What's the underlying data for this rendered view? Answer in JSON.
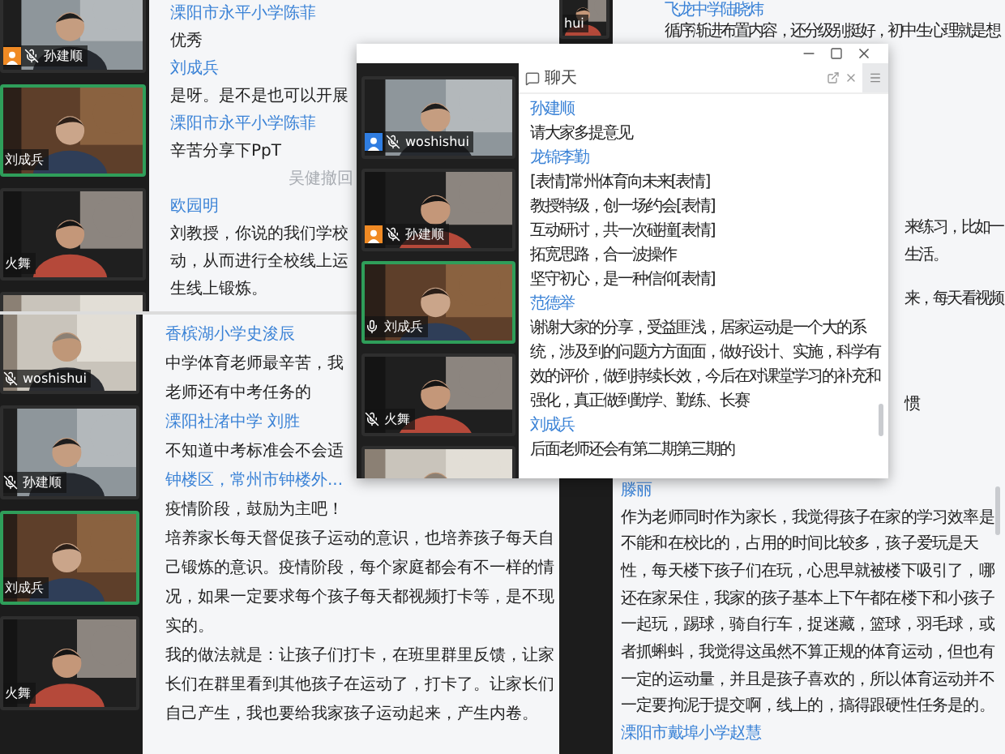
{
  "screens": [
    {
      "tiles": [
        {
          "label": "孙建顺",
          "color": "#f08a24",
          "muted": true,
          "speaking": false
        },
        {
          "label": "刘成兵",
          "speaking": true
        },
        {
          "label": "火舞",
          "speaking": false
        },
        {
          "speaking": false
        }
      ],
      "messages": [
        {
          "kind": "name",
          "text": "溧阳市永平小学陈菲"
        },
        {
          "kind": "text",
          "text": "优秀"
        },
        {
          "kind": "name",
          "text": "刘成兵"
        },
        {
          "kind": "text",
          "text": "是呀。是不是也可以开展"
        },
        {
          "kind": "name",
          "text": "溧阳市永平小学陈菲"
        },
        {
          "kind": "text",
          "text": "辛苦分享下PpT"
        },
        {
          "kind": "notice",
          "text": "吴健撤回"
        },
        {
          "kind": "name",
          "text": "欧园明"
        },
        {
          "kind": "text",
          "text": "刘教授，你说的我们学校"
        },
        {
          "kind": "text",
          "text": "动，从而进行全校线上运"
        },
        {
          "kind": "text",
          "text": "生线上锻炼。"
        }
      ]
    },
    {
      "tiles": [
        {
          "label": "woshishui",
          "muted": true,
          "speaking": false
        },
        {
          "label": "孙建顺",
          "muted": true,
          "speaking": false
        },
        {
          "label": "刘成兵",
          "speaking": true
        },
        {
          "label": "火舞",
          "speaking": false
        }
      ],
      "messages": [
        {
          "kind": "name",
          "text": "香槟湖小学史浚辰"
        },
        {
          "kind": "text",
          "text": "中学体育老师最辛苦，我"
        },
        {
          "kind": "text",
          "text": "老师还有中考任务的"
        },
        {
          "kind": "name",
          "text": "溧阳社渚中学  刘胜"
        },
        {
          "kind": "text",
          "text": "不知道中考标准会不会适"
        },
        {
          "kind": "name",
          "text": "钟楼区，常州市钟楼外..."
        },
        {
          "kind": "text",
          "text": "疫情阶段，鼓励为主吧！"
        },
        {
          "kind": "text",
          "text": "培养家长每天督促孩子运动的意识，也培养孩子每天自己锻炼的意识。疫情阶段，每个家庭都会有不一样的情况，如果一定要求每个孩子每天都视频打卡等，是不现实的。"
        },
        {
          "kind": "text",
          "text": "我的做法就是：让孩子们打卡，在班里群里反馈，让家长们在群里看到其他孩子在运动了，打卡了。让家长们自己产生，我也要给我家孩子运动起来，产生内卷。"
        }
      ]
    },
    {
      "tiles": [
        {
          "label": "hui",
          "speaking": false
        }
      ],
      "messages": [
        {
          "kind": "name",
          "text": "飞龙中学陆晓炜"
        },
        {
          "kind": "text",
          "text": "循序渐进布置内容，还分级别挺好，初中生心理就是想"
        },
        {
          "kind": "fragment",
          "text": "来练习，比如一"
        },
        {
          "kind": "fragment",
          "text": "生活。"
        },
        {
          "kind": "fragment",
          "text": "来，每天看视频"
        },
        {
          "kind": "fragment",
          "text": "惯"
        },
        {
          "kind": "name",
          "text": "滕丽"
        },
        {
          "kind": "text",
          "text": "作为老师同时作为家长，我觉得孩子在家的学习效率是不能和在校比的，占用的时间比较多，孩子爱玩是天性，每天楼下孩子们在玩，心思早就被楼下吸引了，哪还在家呆住，我家的孩子基本上下午都在楼下和小孩子一起玩，踢球，骑自行车，捉迷藏，篮球，羽毛球，或者抓蝌蚪，我觉得这虽然不算正规的体育运动，但也有一定的运动量，并且是孩子喜欢的，所以体育运动并不一定要拘泥于提交啊，线上的，搞得跟硬性任务是的。"
        },
        {
          "kind": "name",
          "text": "溧阳市戴埠小学赵慧"
        }
      ]
    }
  ],
  "chat_window": {
    "title": "聊天",
    "tiles": [
      {
        "label": "woshishui",
        "color": "#2f7de1",
        "muted": true,
        "speaking": false
      },
      {
        "label": "孙建顺",
        "color": "#f08a24",
        "muted": true,
        "speaking": false
      },
      {
        "label": "刘成兵",
        "muted": false,
        "speaking": true
      },
      {
        "label": "火舞",
        "muted": true,
        "speaking": false
      },
      {
        "speaking": false
      }
    ],
    "messages": [
      {
        "kind": "name",
        "text": "孙建顺"
      },
      {
        "kind": "text",
        "text": "请大家多提意见"
      },
      {
        "kind": "name",
        "text": "龙锦李勤"
      },
      {
        "kind": "text",
        "text": " [表情]常州体育向未来[表情]"
      },
      {
        "kind": "text",
        "text": "教授特级，创一场约会[表情]"
      },
      {
        "kind": "text",
        "text": "互动研讨，共一次碰撞[表情]"
      },
      {
        "kind": "text",
        "text": "拓宽思路，合一波操作"
      },
      {
        "kind": "text",
        "text": "坚守初心，是一种信仰[表情]"
      },
      {
        "kind": "name",
        "text": "范德举"
      },
      {
        "kind": "text",
        "text": "谢谢大家的分享，受益匪浅，居家运动是一个大的系统，涉及到的问题方方面面，做好设计、实施，科学有效的评价，做到持续长效，今后在对课堂学习的补充和强化，真正做到勤学、勤练、长赛"
      },
      {
        "kind": "name",
        "text": "刘成兵"
      },
      {
        "kind": "text",
        "text": "后面老师还会有第二期第三期的"
      }
    ]
  }
}
